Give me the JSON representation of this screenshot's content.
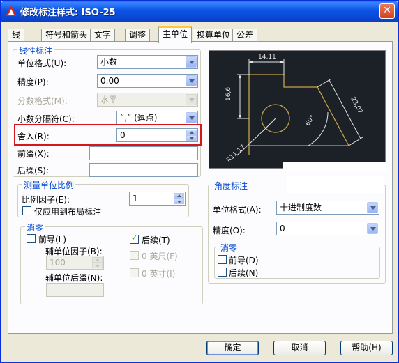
{
  "window": {
    "title": "修改标注样式: ISO-25",
    "close_symbol": "✕"
  },
  "tabs": [
    {
      "label": "线"
    },
    {
      "label": "符号和箭头"
    },
    {
      "label": "文字"
    },
    {
      "label": "调整"
    },
    {
      "label": "主单位"
    },
    {
      "label": "换算单位"
    },
    {
      "label": "公差"
    }
  ],
  "linear": {
    "group_title": "线性标注",
    "unit_format_label": "单位格式(U):",
    "unit_format_value": "小数",
    "precision_label": "精度(P):",
    "precision_value": "0.00",
    "fraction_format_label": "分数格式(M):",
    "fraction_format_value": "水平",
    "decimal_sep_label": "小数分隔符(C):",
    "decimal_sep_value": "“,” (逗点)",
    "roundoff_label": "舍入(R):",
    "roundoff_value": "0",
    "prefix_label": "前缀(X):",
    "prefix_value": "",
    "suffix_label": "后缀(S):",
    "suffix_value": ""
  },
  "scale": {
    "group_title": "测量单位比例",
    "factor_label": "比例因子(E):",
    "factor_value": "1",
    "layout_only_label": "仅应用到布局标注"
  },
  "zero_suppress": {
    "group_title": "消零",
    "leading_label": "前导(L)",
    "trailing_label": "后续(T)",
    "sub_unit_factor_label": "辅单位因子(B):",
    "sub_unit_factor_value": "100",
    "sub_unit_suffix_label": "辅单位后缀(N):",
    "sub_unit_suffix_value": "",
    "feet_label": "0 英尺(F)",
    "inches_label": "0 英寸(I)"
  },
  "angular": {
    "group_title": "角度标注",
    "unit_format_label": "单位格式(A):",
    "unit_format_value": "十进制度数",
    "precision_label": "精度(O):",
    "precision_value": "0",
    "zero_group_title": "消零",
    "leading_label": "前导(D)",
    "trailing_label": "后续(N)"
  },
  "preview": {
    "dim_top": "14,11",
    "dim_left": "16,6",
    "dim_right": "23,07",
    "dim_angle": "60°",
    "dim_radius": "R11,17"
  },
  "buttons": {
    "ok_label": "确定",
    "cancel_label": "取消",
    "help_label": "帮助(H)"
  },
  "colors": {
    "title_blue": "#0a48d4",
    "group_title_blue": "#0046d5",
    "highlight_red": "#d6161d",
    "preview_bg": "#1b2126",
    "preview_line": "#c8a24a"
  }
}
